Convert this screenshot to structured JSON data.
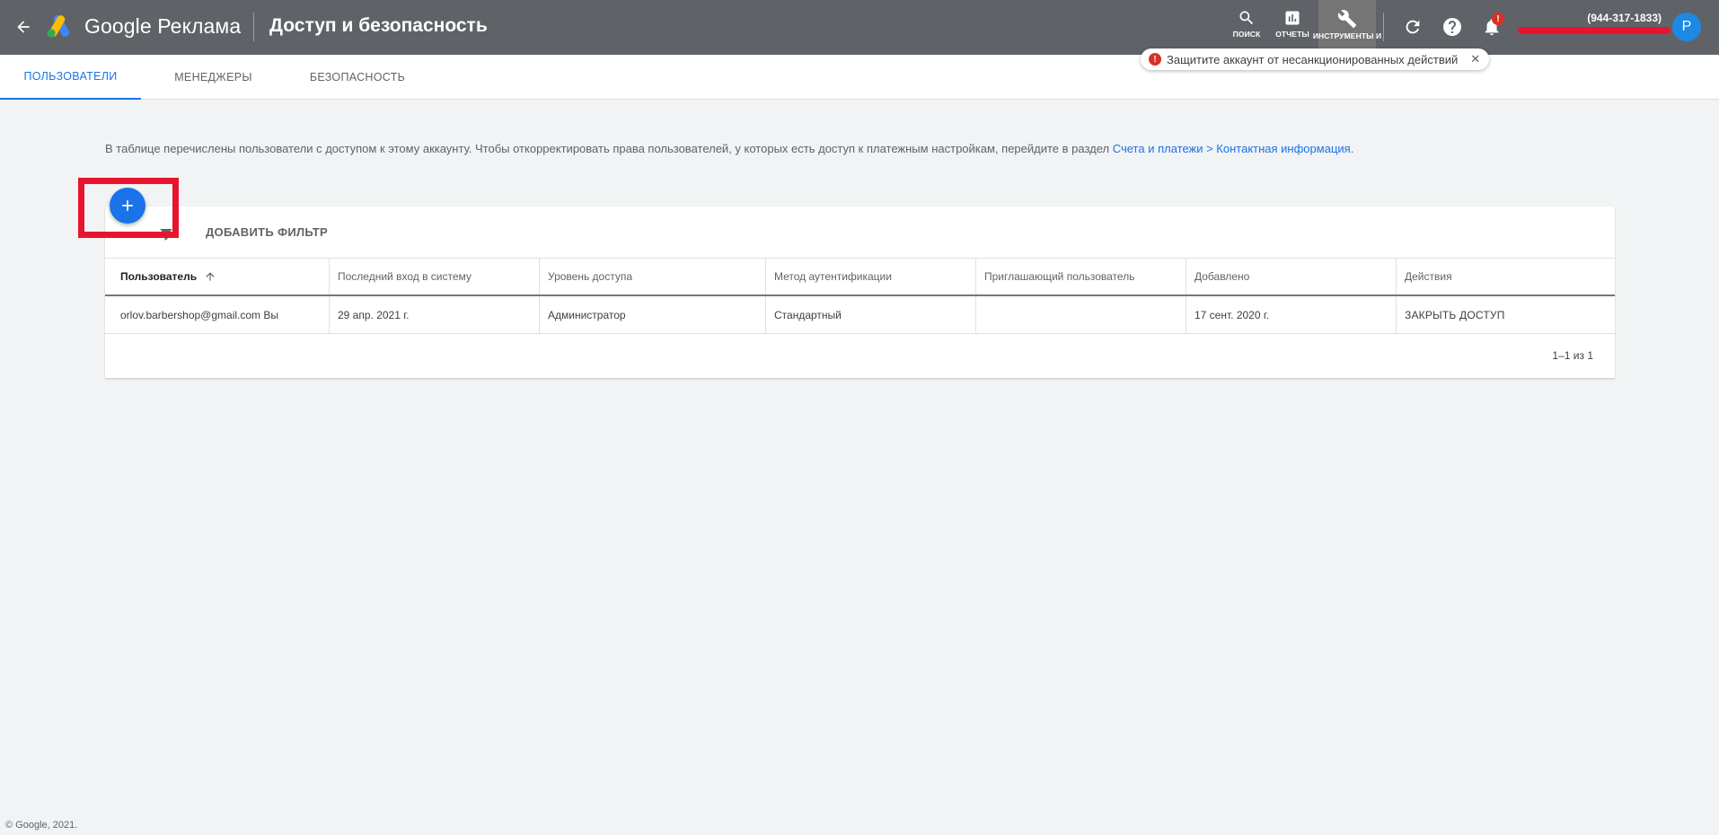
{
  "app": {
    "brand": "Google Реклама",
    "page_title": "Доступ и безопасность"
  },
  "toolbar": {
    "search_label": "ПОИСК",
    "reports_label": "ОТЧЕТЫ",
    "tools_label": "ИНСТРУМЕНТЫ И",
    "notification_badge": "!",
    "account_id": "(944-317-1833)",
    "avatar_letter": "P"
  },
  "alert": {
    "icon": "!",
    "text": "Защитите аккаунт от несанкционированных действий",
    "close": "✕"
  },
  "tabs": [
    {
      "label": "ПОЛЬЗОВАТЕЛИ",
      "active": true
    },
    {
      "label": "МЕНЕДЖЕРЫ",
      "active": false
    },
    {
      "label": "БЕЗОПАСНОСТЬ",
      "active": false
    }
  ],
  "description": {
    "text": "В таблице перечислены пользователи с доступом к этому аккаунту. Чтобы откорректировать права пользователей, у которых есть доступ к платежным настройкам, перейдите в раздел ",
    "link": "Счета и платежи > Контактная информация",
    "end": "."
  },
  "filter": {
    "add_filter_label": "ДОБАВИТЬ ФИЛЬТР"
  },
  "table": {
    "columns": [
      "Пользователь",
      "Последний вход в систему",
      "Уровень доступа",
      "Метод аутентификации",
      "Приглашающий пользователь",
      "Добавлено",
      "Действия"
    ],
    "rows": [
      {
        "user": "orlov.barbershop@gmail.com Вы",
        "last_login": "29 апр. 2021 г.",
        "access_level": "Администратор",
        "auth_method": "Стандартный",
        "inviter": "",
        "added": "17 сент. 2020 г.",
        "action": "ЗАКРЫТЬ ДОСТУП"
      }
    ],
    "pagination": "1–1 из 1"
  },
  "footer": {
    "copyright": "© Google, 2021."
  },
  "colors": {
    "topbar": "#5f6368",
    "accent": "#1a73e8",
    "highlight": "#e8142d",
    "alert": "#d93025"
  }
}
